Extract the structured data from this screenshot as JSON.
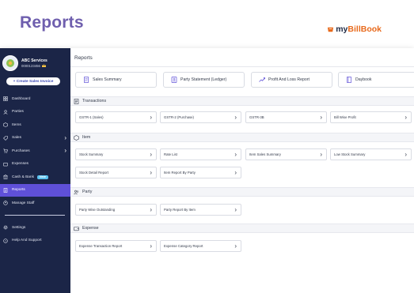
{
  "headline": "Reports",
  "brand": {
    "prefix": "my",
    "name": "BillBook"
  },
  "sidebar": {
    "business_name": "ABC Services",
    "business_phone": "0000123456",
    "create_button": "+ Create Sales Invoice",
    "items": [
      {
        "label": "Dashboard",
        "icon": "dashboard-icon",
        "chevron": false
      },
      {
        "label": "Parties",
        "icon": "parties-icon",
        "chevron": false
      },
      {
        "label": "Items",
        "icon": "items-icon",
        "chevron": false
      },
      {
        "label": "Sales",
        "icon": "sales-icon",
        "chevron": true
      },
      {
        "label": "Purchases",
        "icon": "cart-icon",
        "chevron": true
      },
      {
        "label": "Expenses",
        "icon": "wallet-icon",
        "chevron": false
      },
      {
        "label": "Cash & Bank",
        "icon": "bank-icon",
        "chevron": false,
        "badge": "New"
      },
      {
        "label": "Reports",
        "icon": "reports-icon",
        "chevron": false,
        "active": true
      },
      {
        "label": "Manage Staff",
        "icon": "staff-icon",
        "chevron": false
      }
    ],
    "bottom_items": [
      {
        "label": "Settings",
        "icon": "gear-icon"
      },
      {
        "label": "Help And Support",
        "icon": "help-icon"
      }
    ]
  },
  "main": {
    "title": "Reports",
    "quick_links": [
      {
        "label": "Sales Summary",
        "icon": "document-icon"
      },
      {
        "label": "Party Statement (Ledger)",
        "icon": "id-card-icon"
      },
      {
        "label": "Profit And Loss Report",
        "icon": "trend-chart-icon"
      },
      {
        "label": "Daybook",
        "icon": "book-icon"
      }
    ],
    "sections": {
      "transactions": {
        "title": "Transactions",
        "cards": [
          "GSTR-1 (Sales)",
          "GSTR-2 (Purchase)",
          "GSTR-3B",
          "Bill Wise Profit"
        ]
      },
      "item": {
        "title": "Item",
        "cards": [
          "Stock Summary",
          "Rate List",
          "Item Sales Summary",
          "Low Stock Summary",
          "Stock Detail Report",
          "Item Report By Party"
        ]
      },
      "party": {
        "title": "Party",
        "cards": [
          "Party Wise Outstanding",
          "Party Report By Item"
        ]
      },
      "expense": {
        "title": "Expense",
        "cards": [
          "Expense Transaction Report",
          "Expense Category Report"
        ]
      }
    }
  },
  "colors": {
    "sidebar_bg": "#1b2547",
    "active_item": "#5f50d8",
    "headline": "#6f5fae",
    "brand_accent": "#e86a1c",
    "new_badge": "#5cc2ef"
  }
}
